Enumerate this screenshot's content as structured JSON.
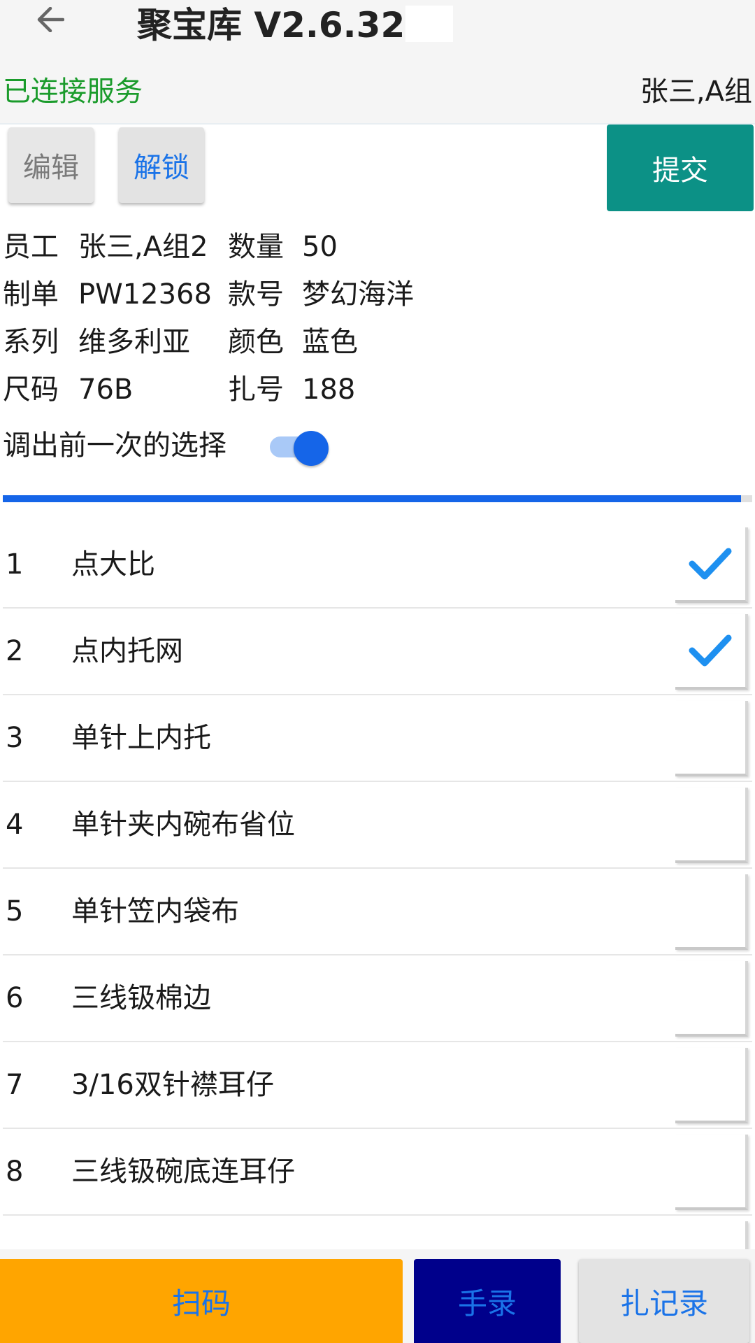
{
  "header": {
    "title": "聚宝库 V2.6.32",
    "back_icon": "arrow-left-icon"
  },
  "status": {
    "connection": "已连接服务",
    "connection_color": "#1a9b2b",
    "user": "张三,A组"
  },
  "toolbar": {
    "edit_label": "编辑",
    "unlock_label": "解锁",
    "submit_label": "提交",
    "submit_color": "#0c9186"
  },
  "info": {
    "employee_label": "员工",
    "employee_value": "张三,A组2",
    "quantity_label": "数量",
    "quantity_value": "50",
    "order_label": "制单",
    "order_value": "PW12368",
    "style_label": "款号",
    "style_value": "梦幻海洋",
    "series_label": "系列",
    "series_value": "维多利亚",
    "color_label": "颜色",
    "color_value": "蓝色",
    "size_label": "尺码",
    "size_value": "76B",
    "bundle_label": "扎号",
    "bundle_value": "188"
  },
  "toggle": {
    "label": "调出前一次的选择",
    "on": true
  },
  "progress": {
    "fraction": 0.985
  },
  "operations": [
    {
      "num": "1",
      "name": "点大比",
      "checked": true
    },
    {
      "num": "2",
      "name": "点内托网",
      "checked": true
    },
    {
      "num": "3",
      "name": "单针上内托",
      "checked": false
    },
    {
      "num": "4",
      "name": "单针夹内碗布省位",
      "checked": false
    },
    {
      "num": "5",
      "name": "单针笠内袋布",
      "checked": false
    },
    {
      "num": "6",
      "name": "三线钑棉边",
      "checked": false
    },
    {
      "num": "7",
      "name": "3/16双针襟耳仔",
      "checked": false
    },
    {
      "num": "8",
      "name": "三线钑碗底连耳仔",
      "checked": false
    },
    {
      "num": "",
      "name": "",
      "checked": false
    }
  ],
  "bottom": {
    "scan_label": "扫码",
    "manual_label": "手录",
    "records_label": "扎记录",
    "scan_color": "#ffa500",
    "manual_color": "#00008b"
  }
}
